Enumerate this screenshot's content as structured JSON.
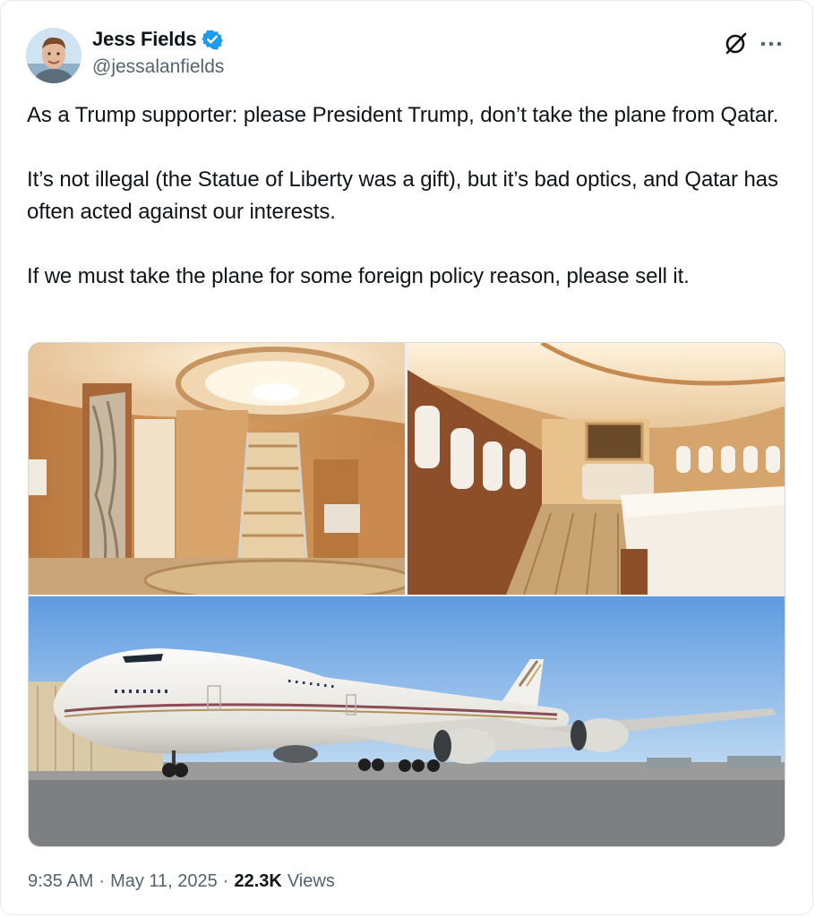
{
  "author": {
    "name": "Jess Fields",
    "handle": "@jessalanfields",
    "verified": true,
    "avatar_icon": "avatar-photo",
    "verified_color": "#1d9bf0"
  },
  "header_icons": [
    "grok-icon",
    "more-options-icon"
  ],
  "tweet": {
    "paragraphs": [
      "As a Trump supporter: please President Trump, don’t take the plane from Qatar.",
      "It’s not illegal (the Statue of Liberty was a gift), but it’s bad optics, and Qatar has often acted against our interests.",
      "If we must take the plane for some foreign policy reason, please sell it."
    ]
  },
  "media": {
    "images": [
      "aircraft-interior-staircase-photo",
      "aircraft-interior-bedroom-photo",
      "boeing-747-on-tarmac-photo"
    ]
  },
  "footer": {
    "time": "9:35 AM",
    "sep1": "·",
    "date": "May 11, 2025",
    "sep2": "·",
    "views_count": "22.3K",
    "views_label": "Views"
  }
}
